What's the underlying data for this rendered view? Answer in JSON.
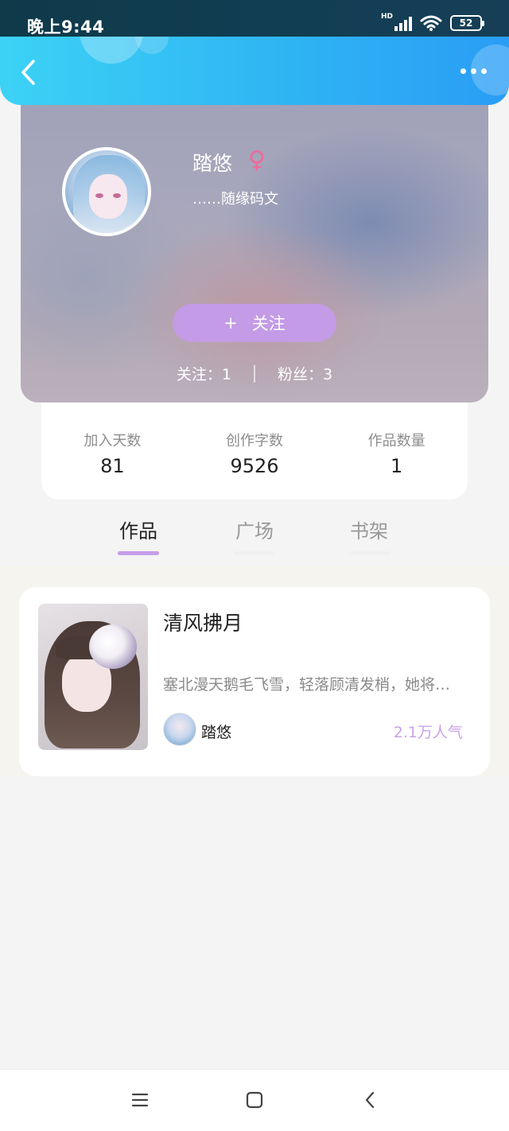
{
  "status_bar": {
    "time": "晚上9:44",
    "network": "HD",
    "battery": "52"
  },
  "profile": {
    "username": "踏悠",
    "gender_symbol": "♀",
    "bio": "……随缘码文",
    "follow_button_icon": "+",
    "follow_button_label": "关注",
    "following": "关注：1",
    "followers": "粉丝：3"
  },
  "stats": [
    {
      "label": "加入天数",
      "value": "81"
    },
    {
      "label": "创作字数",
      "value": "9526"
    },
    {
      "label": "作品数量",
      "value": "1"
    }
  ],
  "tabs": [
    {
      "label": "作品",
      "active": true
    },
    {
      "label": "广场",
      "active": false
    },
    {
      "label": "书架",
      "active": false
    }
  ],
  "works": [
    {
      "title": "清风拂月",
      "description": "塞北漫天鹅毛飞雪，轻落顾清发梢，她将…",
      "author": "踏悠",
      "popularity": "2.1万人气"
    }
  ],
  "icons": {
    "back": "chevron-left-icon",
    "more": "more-dots-icon",
    "gender": "female-icon",
    "nav_menu": "menu-icon",
    "nav_home": "square-icon",
    "nav_back": "back-icon"
  },
  "colors": {
    "header_gradient_start": "#3cd2f5",
    "header_gradient_end": "#2a9df5",
    "accent_purple": "#c39be6",
    "gender_pink": "#f06a9a"
  }
}
